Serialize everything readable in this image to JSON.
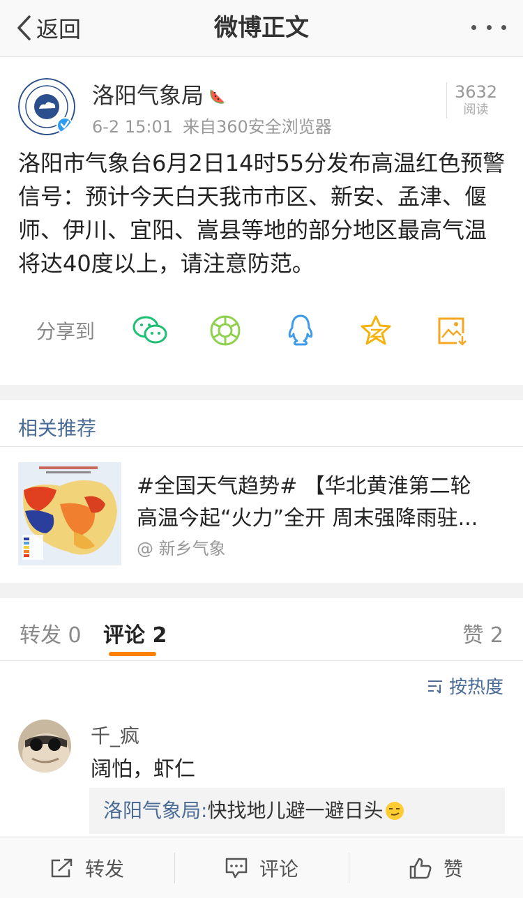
{
  "nav": {
    "back_label": "返回",
    "title": "微博正文"
  },
  "post": {
    "author": "洛阳气象局",
    "time": "6-2 15:01",
    "source": "来自360安全浏览器",
    "read_count": "3632",
    "read_label": "阅读",
    "text": "洛阳市气象台6月2日14时55分发布高温红色预警信号：预计今天白天我市市区、新安、孟津、偃师、伊川、宜阳、嵩县等地的部分地区最高气温将达40度以上，请注意防范。",
    "share_label": "分享到"
  },
  "related": {
    "heading": "相关推荐",
    "title_line1": "#全国天气趋势# 【华北黄淮第二轮",
    "title_line2": "高温今起“火力”全开 周末强降雨驻...",
    "source": "@ 新乡气象"
  },
  "tabs": {
    "repost_label": "转发",
    "repost_count": "0",
    "comment_label": "评论",
    "comment_count": "2",
    "like_label": "赞",
    "like_count": "2"
  },
  "sort_label": "按热度",
  "comment": {
    "user": "千_疯",
    "text": "阔怕，虾仁",
    "reply_user": "洛阳气象局:",
    "reply_text": "快找地儿避一避日头"
  },
  "bottom": {
    "repost": "转发",
    "comment": "评论",
    "like": "赞"
  },
  "colors": {
    "accent": "#ff8200",
    "link": "#4a6c96",
    "verified": "#2f9cf0"
  }
}
